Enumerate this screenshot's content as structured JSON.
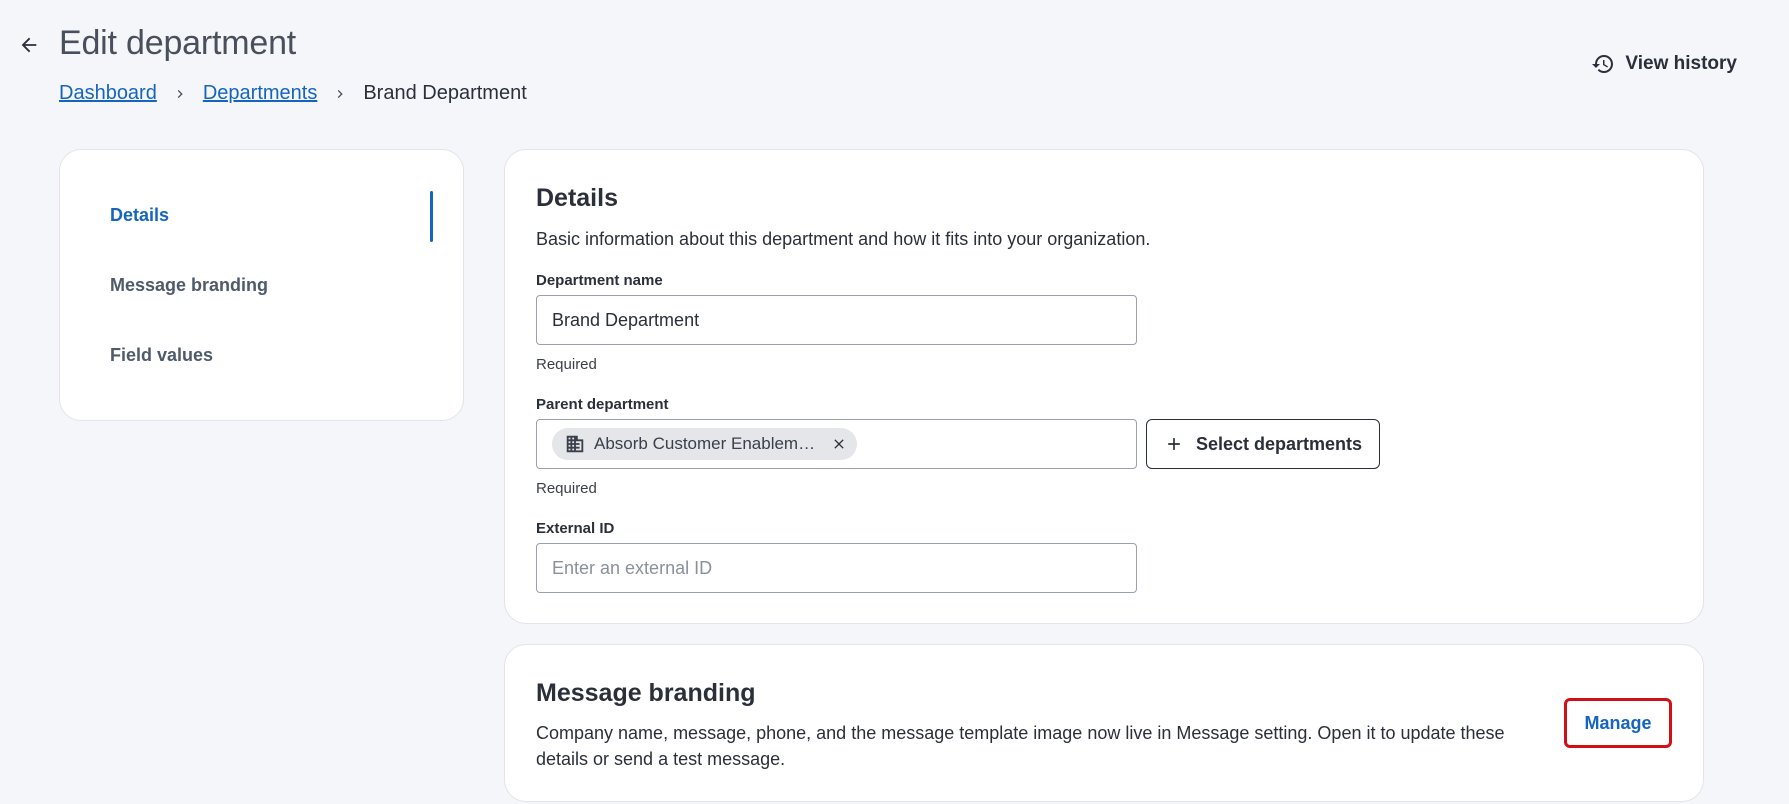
{
  "header": {
    "title": "Edit department",
    "history_label": "View history"
  },
  "breadcrumb": {
    "items": [
      {
        "label": "Dashboard"
      },
      {
        "label": "Departments"
      },
      {
        "label": "Brand Department"
      }
    ]
  },
  "sidebar": {
    "items": [
      {
        "label": "Details",
        "active": true
      },
      {
        "label": "Message branding",
        "active": false
      },
      {
        "label": "Field values",
        "active": false
      }
    ]
  },
  "details": {
    "title": "Details",
    "description": "Basic information about this department and how it fits into your organization.",
    "department_name": {
      "label": "Department name",
      "value": "Brand Department",
      "helper": "Required"
    },
    "parent_department": {
      "label": "Parent department",
      "chip_label": "Absorb Customer Enablem…",
      "helper": "Required",
      "select_button_label": "Select departments"
    },
    "external_id": {
      "label": "External ID",
      "value": "",
      "placeholder": "Enter an external ID"
    }
  },
  "message_branding": {
    "title": "Message branding",
    "description": "Company name, message, phone, and the message template image now live in Message setting. Open it to update these details or send a test message.",
    "manage_label": "Manage"
  },
  "colors": {
    "accent": "#1565c0",
    "highlight": "#d10f16",
    "background": "#f5f6f9"
  }
}
